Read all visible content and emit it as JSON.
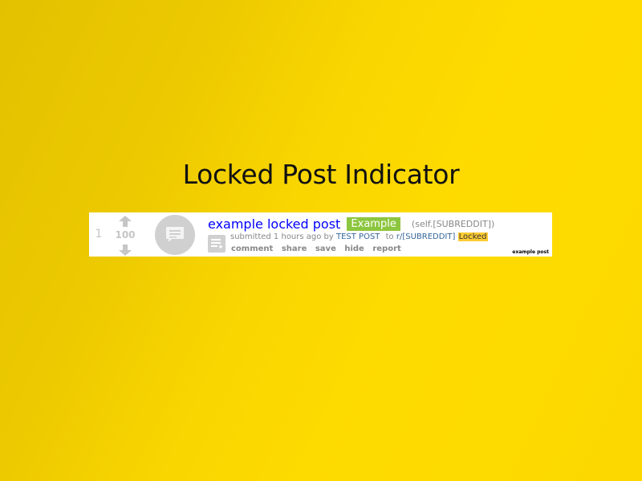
{
  "slide": {
    "title": "Locked Post Indicator"
  },
  "post": {
    "rank": "1",
    "score": "100",
    "title": "example locked post",
    "flair": "Example",
    "domain": "(self.[SUBREDDIT])",
    "tagline_prefix": "submitted 1 hours ago by",
    "author": "TEST POST",
    "to_label": "to",
    "subreddit": "r/[SUBREDDIT]",
    "locked_label": "Locked",
    "buttons": [
      "comment",
      "share",
      "save",
      "hide",
      "report"
    ],
    "caption": "example post"
  },
  "icons": {
    "upvote": "up-arrow-icon",
    "downvote": "down-arrow-icon",
    "thumbnail": "self-post-icon",
    "expando": "expand-text-icon"
  },
  "colors": {
    "background": "#fcd800",
    "title_link": "#0000ff",
    "flair_bg": "#8cc63f",
    "locked_bg": "#ffcc33",
    "author_link": "#336699"
  }
}
